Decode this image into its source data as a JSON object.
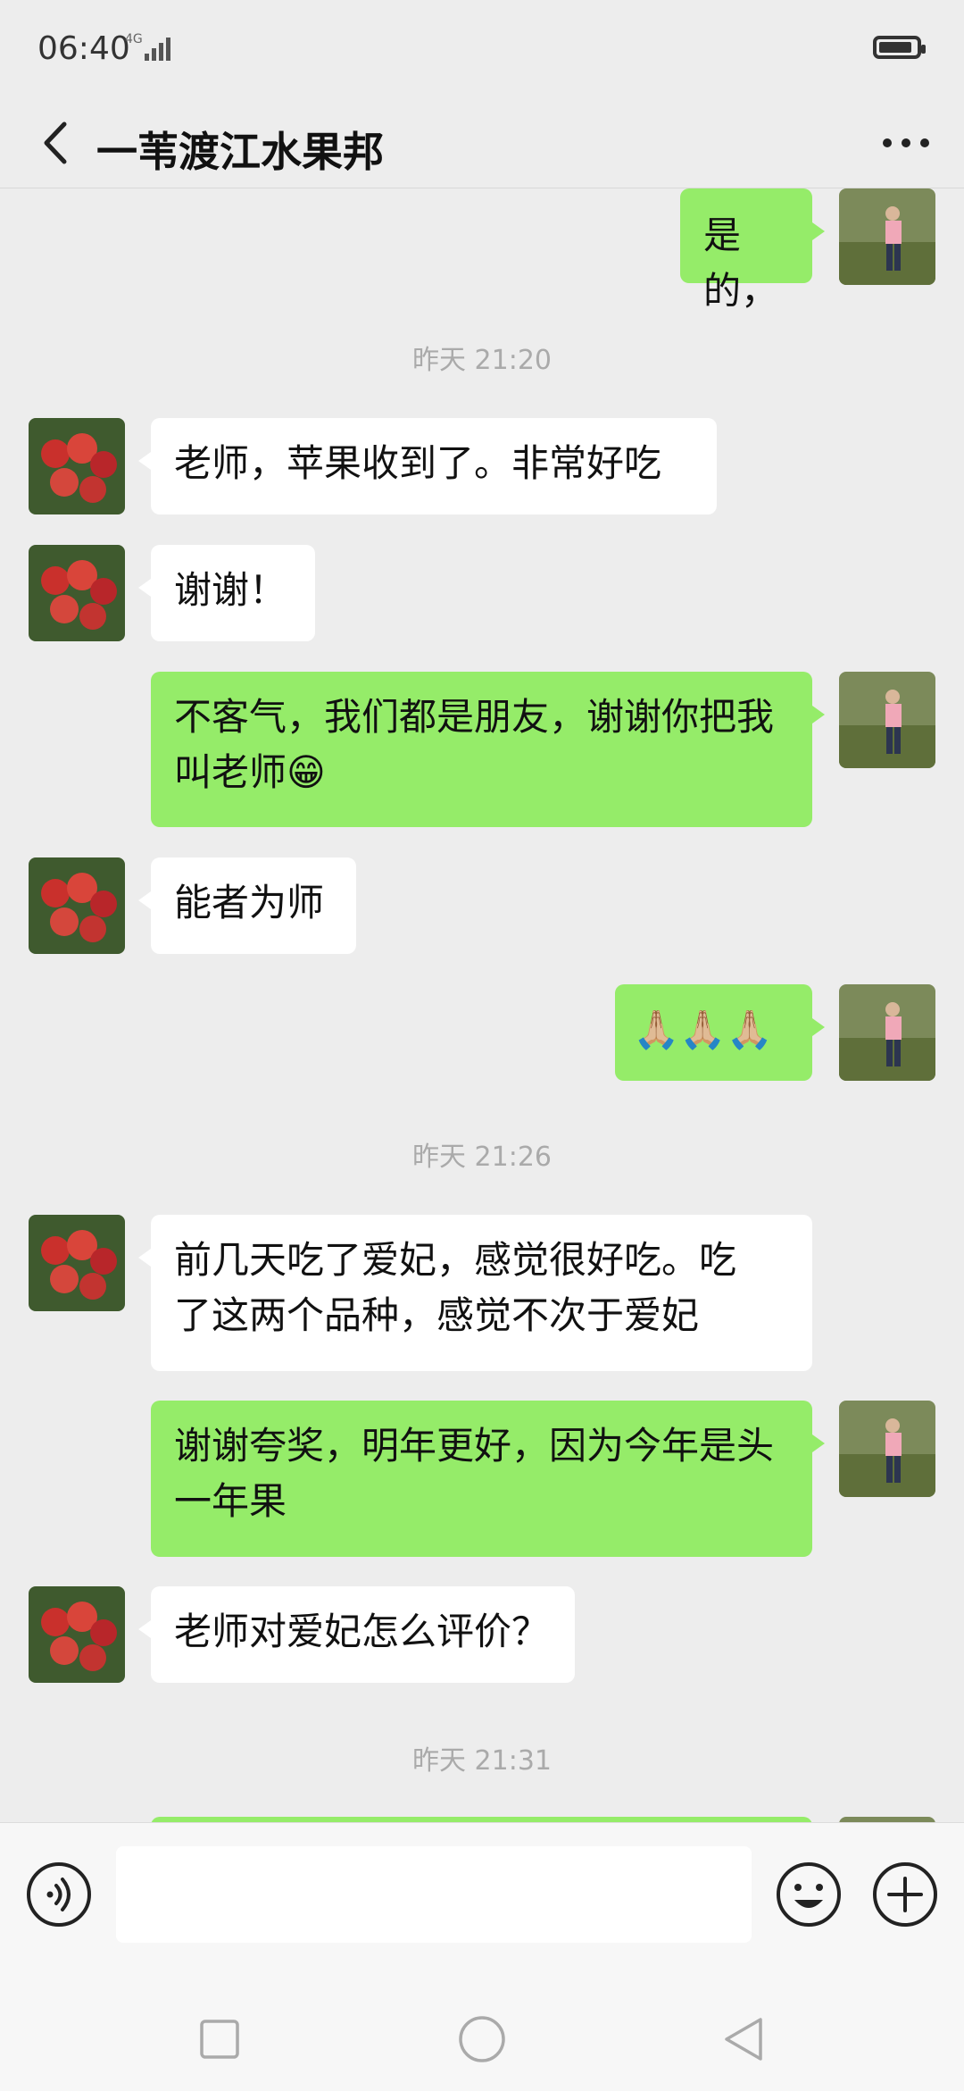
{
  "status_bar": {
    "time": "06:40",
    "network": "4G"
  },
  "header": {
    "title": "一苇渡江水果邦"
  },
  "messages": {
    "m0": "是的，",
    "ts1": "昨天 21:20",
    "m1": "老师，苹果收到了。非常好吃",
    "m2": "谢谢！",
    "m3a": "不客气，我们都是朋友，谢谢你把我",
    "m3b": "叫老师😁",
    "m4": "能者为师",
    "m5": "🙏🏼🙏🏼🙏🏼",
    "ts2": "昨天 21:26",
    "m6a": "前几天吃了爱妃，感觉很好吃。吃",
    "m6b": "了这两个品种，感觉不次于爱妃",
    "m7a": "谢谢夸奖，明年更好，因为今年是头",
    "m7b": "一年果",
    "m8": "老师对爱妃怎么评价？",
    "ts3": "昨天 21:31"
  },
  "icons": {
    "back": "back-arrow-icon",
    "more": "more-dots-icon",
    "voice": "voice-icon",
    "emoji": "emoji-icon",
    "plus": "plus-icon"
  },
  "colors": {
    "outgoing_bubble": "#95ec69",
    "incoming_bubble": "#ffffff",
    "background": "#ededed"
  }
}
